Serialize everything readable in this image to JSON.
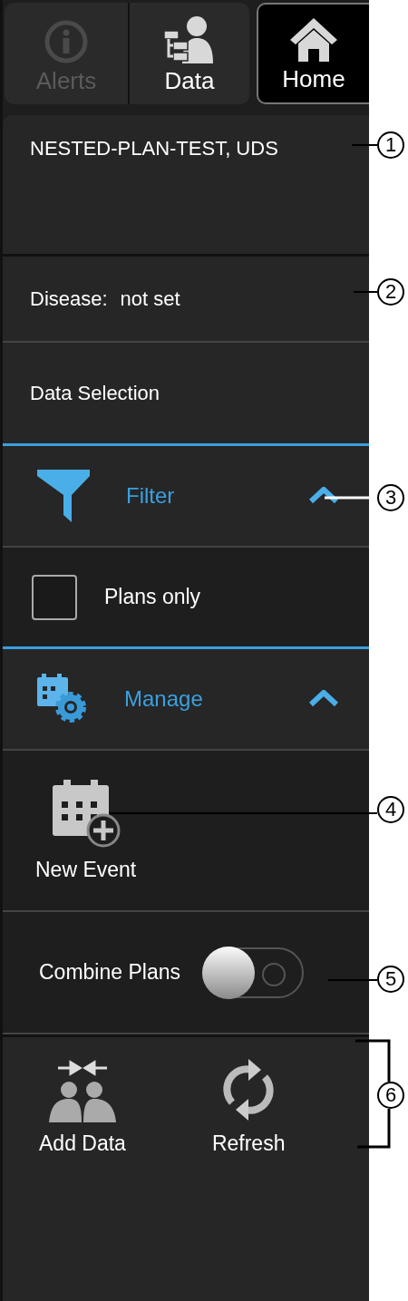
{
  "tabs": [
    {
      "label": "Alerts",
      "kind": "alerts",
      "selected": false,
      "disabled": true
    },
    {
      "label": "Data",
      "kind": "data",
      "selected": false,
      "disabled": false
    },
    {
      "label": "Home",
      "kind": "home",
      "selected": true,
      "disabled": false
    }
  ],
  "patient": {
    "name": "NESTED-PLAN-TEST, UDS"
  },
  "disease": {
    "label": "Disease:",
    "value": "not set"
  },
  "data_selection": {
    "label": "Data Selection"
  },
  "sections": [
    {
      "title": "Filter",
      "kind": "filter",
      "expanded": true,
      "items": [
        {
          "kind": "checkbox",
          "label": "Plans only",
          "checked": false
        }
      ]
    },
    {
      "title": "Manage",
      "kind": "manage",
      "expanded": true,
      "items": [
        {
          "kind": "action",
          "label": "New Event"
        },
        {
          "kind": "toggle",
          "label": "Combine Plans",
          "on": false
        }
      ]
    }
  ],
  "actions": [
    {
      "label": "Add Data",
      "kind": "add-data"
    },
    {
      "label": "Refresh",
      "kind": "refresh"
    }
  ],
  "callouts": [
    {
      "label": "1"
    },
    {
      "label": "2"
    },
    {
      "label": "3"
    },
    {
      "label": "4"
    },
    {
      "label": "5"
    },
    {
      "label": "6"
    }
  ]
}
